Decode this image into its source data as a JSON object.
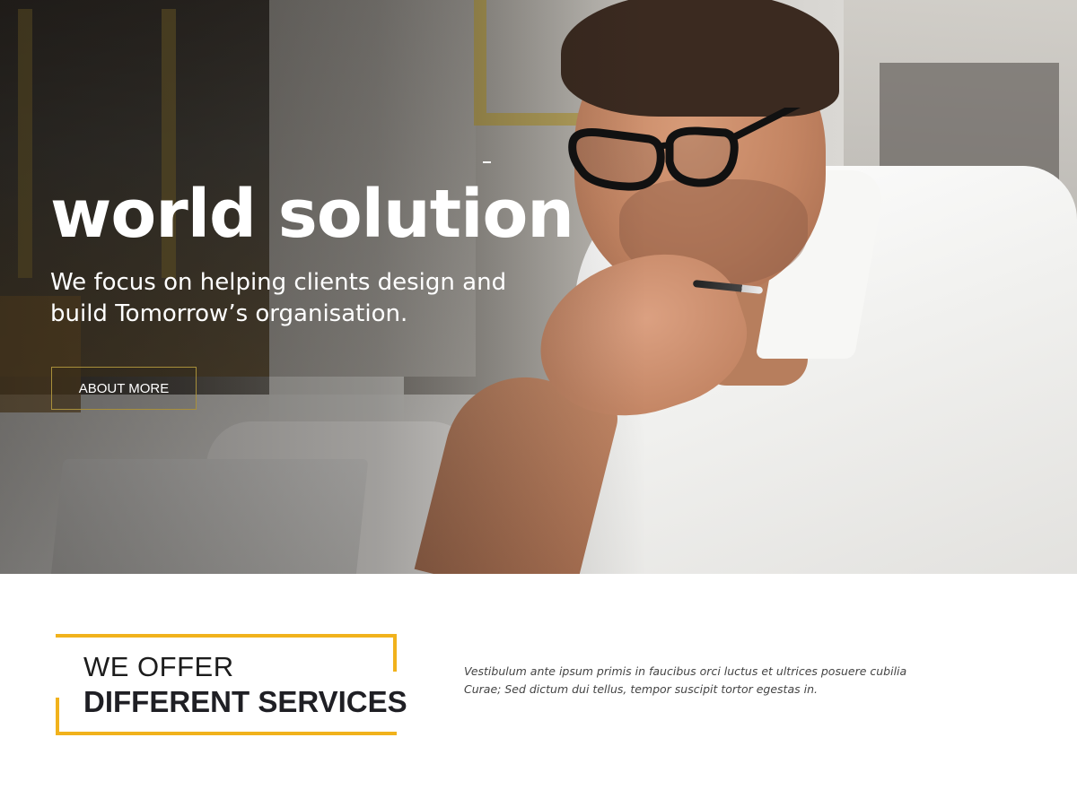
{
  "hero": {
    "title": "world solution",
    "subtitle": "We focus on helping clients design and build Tomorrow’s organisation.",
    "button_label": "ABOUT MORE"
  },
  "services": {
    "heading_line1": "WE OFFER",
    "heading_line2": "DIFFERENT SERVICES",
    "description": "Vestibulum ante ipsum primis in faucibus orci luctus et ultrices posuere cubilia Curae; Sed dictum dui tellus, tempor suscipit tortor egestas in."
  },
  "colors": {
    "accent": "#f1b21c",
    "text_dark": "#1f1f24",
    "button_border": "#a88f3a"
  }
}
